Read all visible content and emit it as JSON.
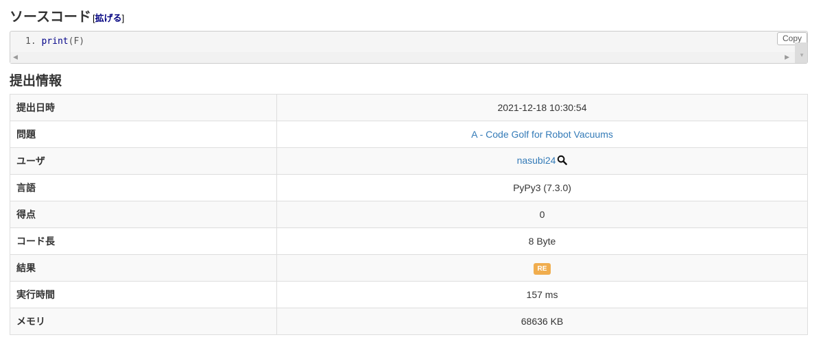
{
  "source_section": {
    "title": "ソースコード",
    "expand_open": "[",
    "expand_link": "拡げる",
    "expand_close": "]"
  },
  "code": {
    "line_number": "1.",
    "fn": "print",
    "args": "(F)",
    "copy_label": "Copy"
  },
  "info_section": {
    "title": "提出情報"
  },
  "info": {
    "rows": [
      {
        "label": "提出日時",
        "value": "2021-12-18 10:30:54"
      },
      {
        "label": "問題",
        "value": "A - Code Golf for Robot Vacuums"
      },
      {
        "label": "ユーザ",
        "value": "nasubi24"
      },
      {
        "label": "言語",
        "value": "PyPy3 (7.3.0)"
      },
      {
        "label": "得点",
        "value": "0"
      },
      {
        "label": "コード長",
        "value": "8 Byte"
      },
      {
        "label": "結果",
        "value": "RE"
      },
      {
        "label": "実行時間",
        "value": "157 ms"
      },
      {
        "label": "メモリ",
        "value": "68636 KB"
      }
    ]
  },
  "colors": {
    "link": "#337ab7",
    "badge_warning": "#f0ad4e",
    "expand_link": "#000080"
  },
  "icons": {
    "user_search": "search-icon"
  }
}
